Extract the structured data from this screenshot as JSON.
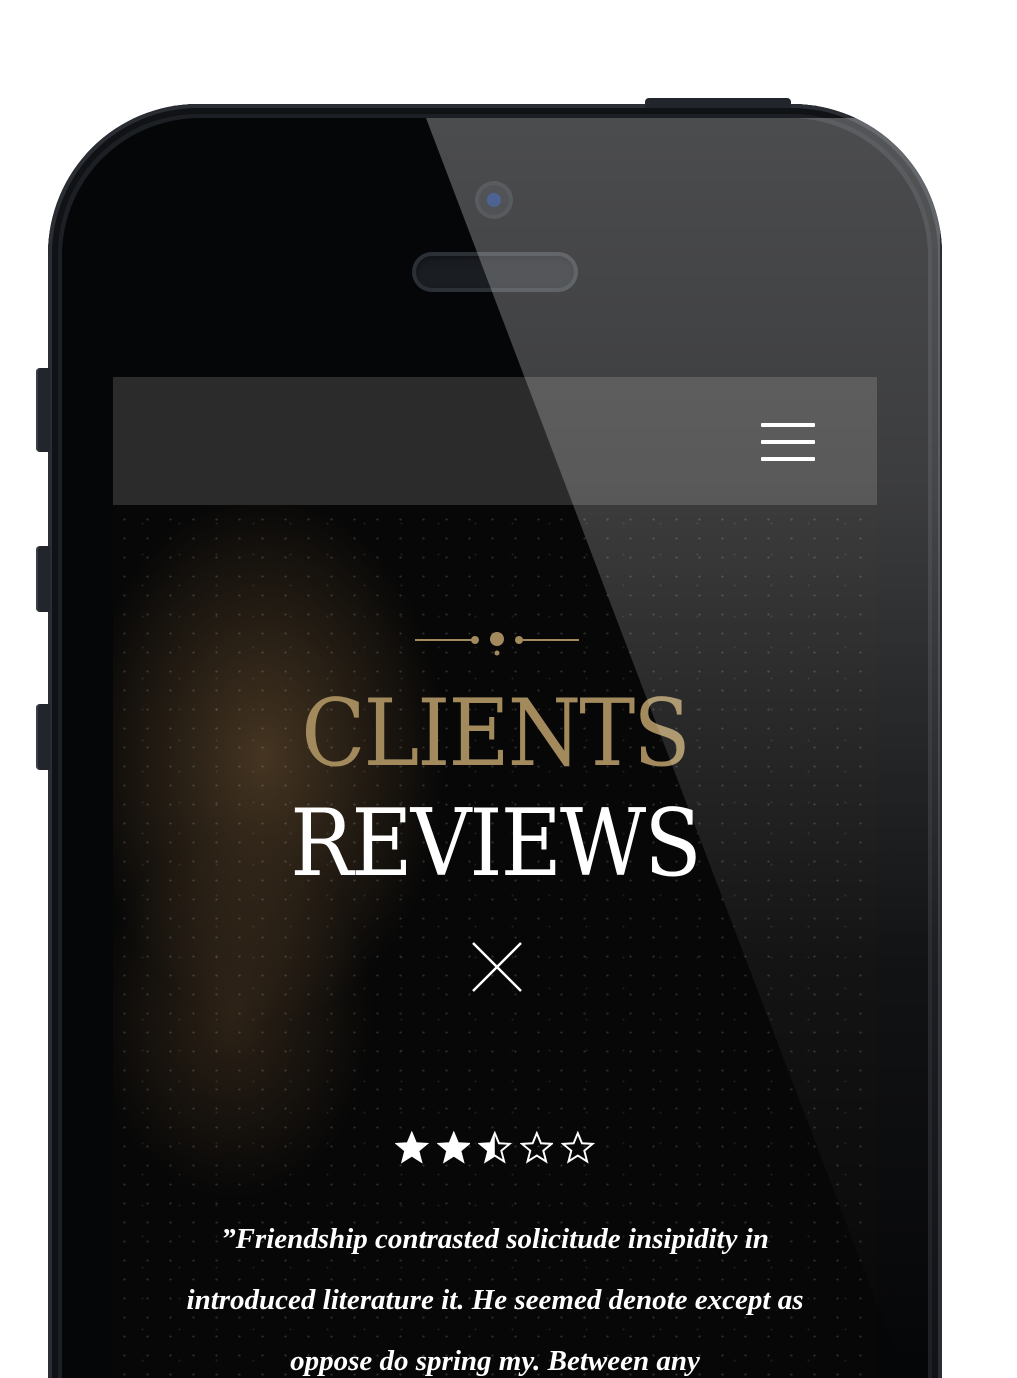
{
  "device": {
    "name": "smartphone"
  },
  "header": {
    "menu_icon": "hamburger-menu-icon"
  },
  "section": {
    "ornament_icon": "decorative-divider-icon",
    "title_line1": "CLIENTS",
    "title_line2": "REVIEWS",
    "close_icon": "close-icon"
  },
  "review": {
    "rating": 2.5,
    "rating_max": 5,
    "text": "”Friendship contrasted solicitude insipidity in introduced literature it. He seemed denote except as oppose do spring my. Between any"
  },
  "colors": {
    "accent_gold": "#a28a5c",
    "text_white": "#ffffff",
    "navbar_bg": "#2b2b2b",
    "screen_bg": "#070707"
  }
}
